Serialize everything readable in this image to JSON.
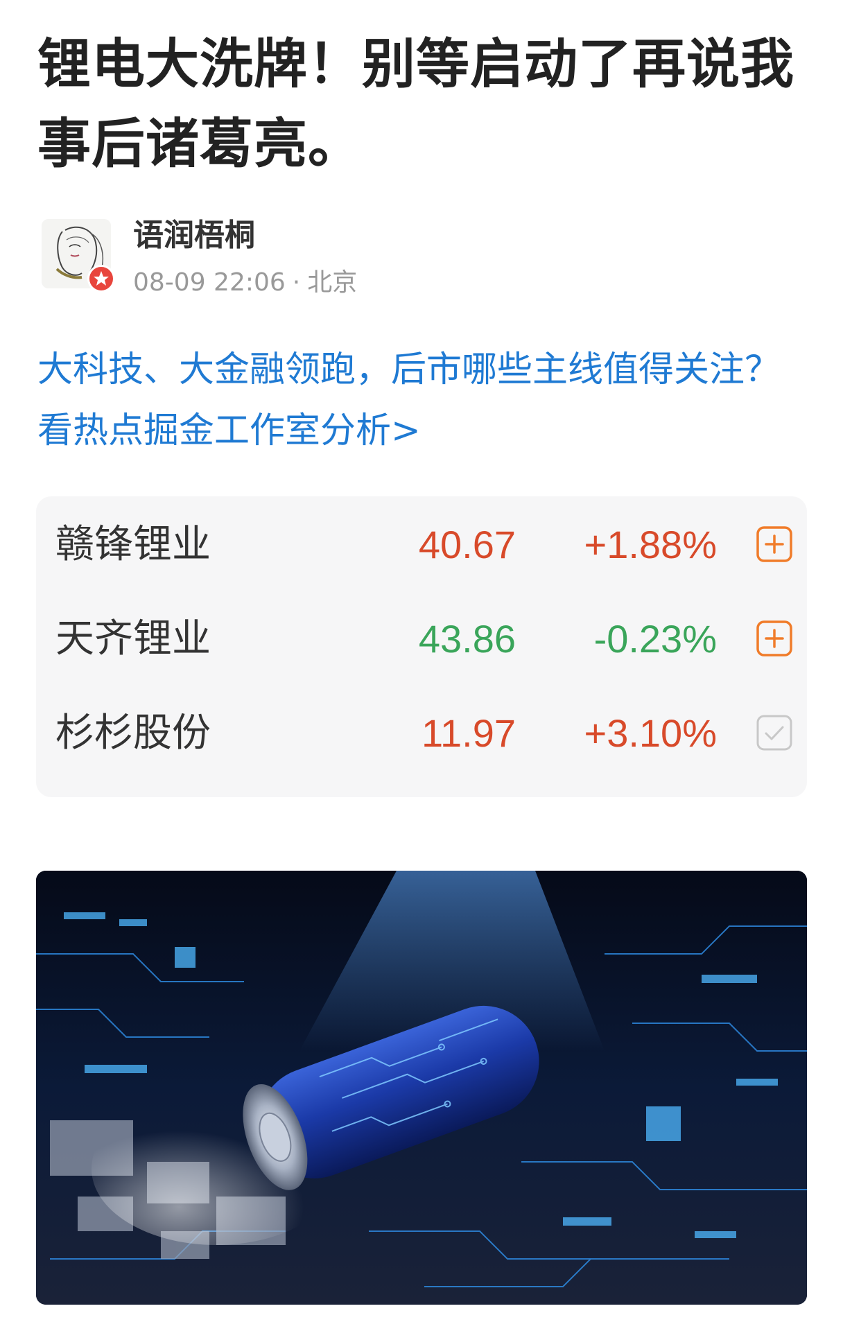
{
  "article": {
    "title": "锂电大洗牌！别等启动了再说我事后诸葛亮。"
  },
  "author": {
    "name": "语润梧桐",
    "date": "08-09 22:06",
    "separator": "·",
    "location": "北京",
    "avatar_icon": "portrait-avatar",
    "badge_icon": "star-badge-icon"
  },
  "promo": {
    "text": "大科技、大金融领跑，后市哪些主线值得关注？看热点掘金工作室分析>"
  },
  "stocks": [
    {
      "name": "赣锋锂业",
      "price": "40.67",
      "change": "+1.88%",
      "trend": "up",
      "action": "add",
      "action_icon": "plus-square-icon"
    },
    {
      "name": "天齐锂业",
      "price": "43.86",
      "change": "-0.23%",
      "trend": "down",
      "action": "add",
      "action_icon": "plus-square-icon"
    },
    {
      "name": "杉杉股份",
      "price": "11.97",
      "change": "+3.10%",
      "trend": "up",
      "action": "added",
      "action_icon": "check-square-icon"
    }
  ],
  "colors": {
    "up": "#d84a2a",
    "down": "#3aa55a",
    "link": "#1f7ad3",
    "add_icon": "#f07c2a",
    "added_icon": "#c8c8c8"
  },
  "hero_image": {
    "icon": "battery-circuit-image"
  }
}
